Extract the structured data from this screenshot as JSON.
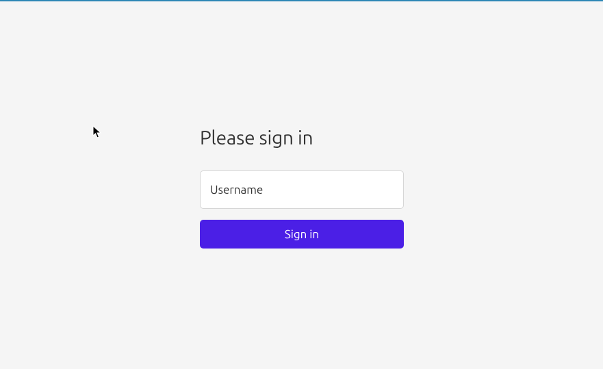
{
  "signin": {
    "heading": "Please sign in",
    "username_placeholder": "Username",
    "username_value": "",
    "button_label": "Sign in"
  }
}
